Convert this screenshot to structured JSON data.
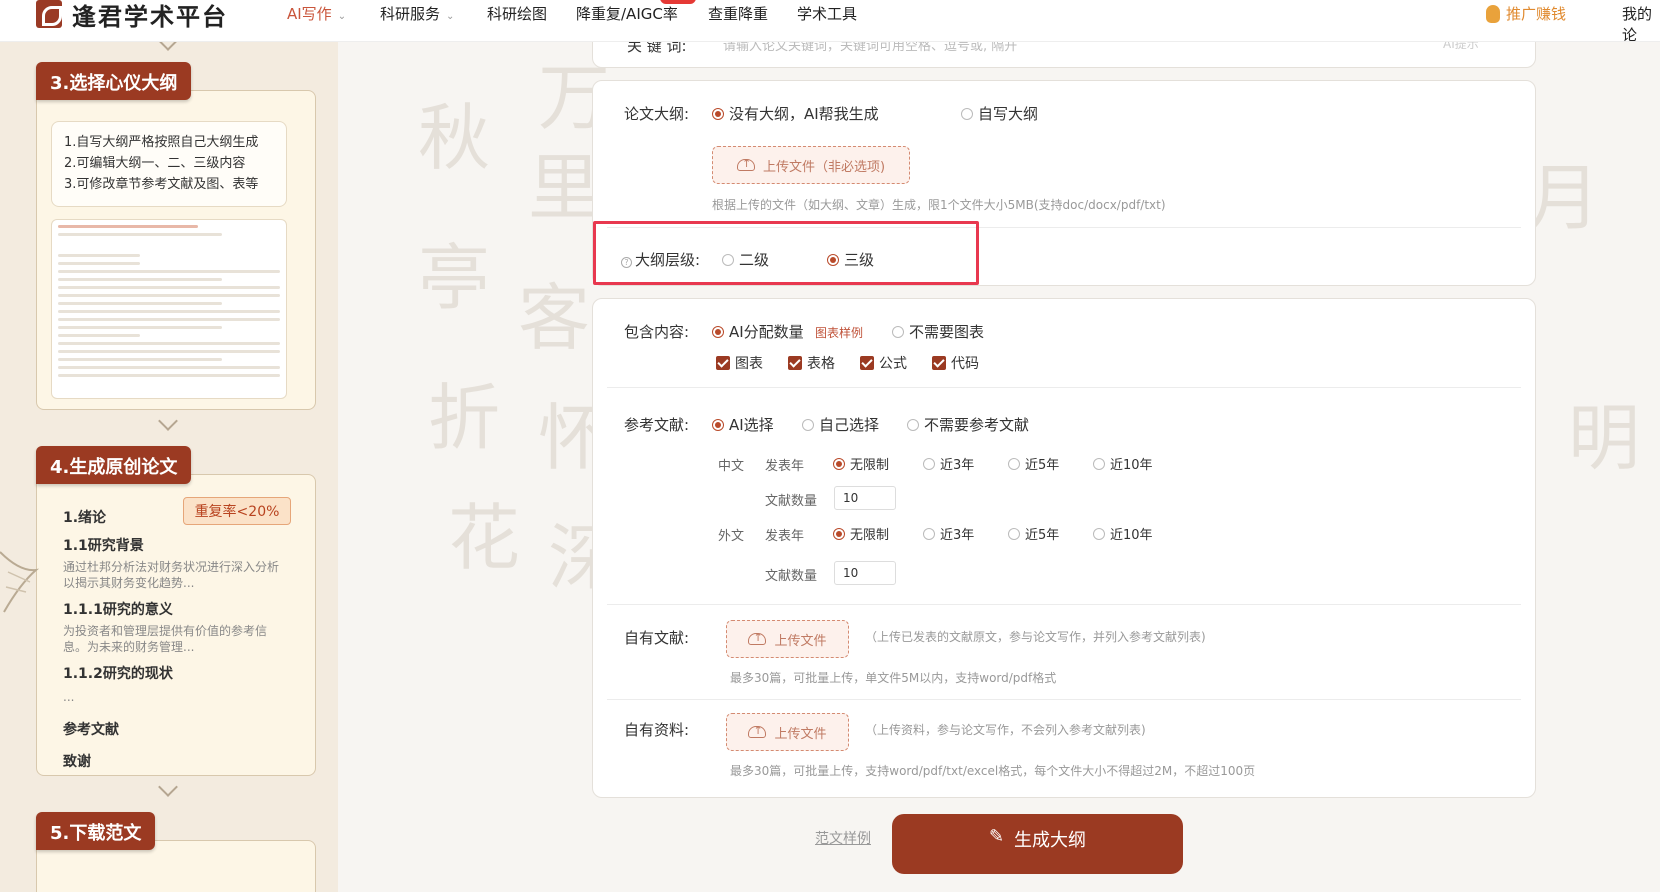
{
  "brand": {
    "name": "逢君学术平台"
  },
  "nav": {
    "items": [
      {
        "label": "AI写作",
        "caret": "⌄"
      },
      {
        "label": "科研服务",
        "caret": "⌄"
      },
      {
        "label": "科研绘图"
      },
      {
        "label": "降重复/AIGC率"
      },
      {
        "label": "查重降重"
      },
      {
        "label": "学术工具"
      }
    ],
    "promo": "推广赚钱",
    "account": "我的论"
  },
  "sidebar": {
    "step3": {
      "title": "3.选择心仪大纲",
      "tips": [
        "1.自写大纲严格按照自己大纲生成",
        "2.可编辑大纲一、二、三级内容",
        "3.可修改章节参考文献及图、表等"
      ]
    },
    "step4": {
      "title": "4.生成原创论文",
      "badge": "重复率<20%",
      "outline": [
        {
          "heading": "1.绪论"
        },
        {
          "heading": "1.1研究背景",
          "text": "通过杜邦分析法对财务状况进行深入分析以揭示其财务变化趋势..."
        },
        {
          "heading": "1.1.1研究的意义",
          "text": "为投资者和管理层提供有价值的参考信息。为未来的财务管理..."
        },
        {
          "heading": "1.1.2研究的现状"
        },
        {
          "heading": "..."
        },
        {
          "heading": "参考文献"
        },
        {
          "heading": "致谢"
        }
      ]
    },
    "step5": {
      "title": "5.下载范文"
    }
  },
  "form": {
    "keywords": {
      "label": "关 键 词:",
      "placeholder": "请输入论文关键词，关键词可用空格、逗号或, 隔开",
      "button": "AI提示"
    },
    "outline": {
      "label": "论文大纲:",
      "options": [
        {
          "label": "没有大纲，AI帮我生成",
          "selected": true
        },
        {
          "label": "自写大纲",
          "selected": false
        }
      ],
      "upload_label": "上传文件（非必选项)",
      "upload_hint": "根据上传的文件（如大纲、文章）生成，限1个文件大小5MB(支持doc/docx/pdf/txt)"
    },
    "level": {
      "label": "大纲层级:",
      "options": [
        {
          "label": "二级",
          "selected": false
        },
        {
          "label": "三级",
          "selected": true
        }
      ]
    },
    "content": {
      "label": "包含内容:",
      "options": [
        {
          "label": "AI分配数量",
          "selected": true
        },
        {
          "label": "不需要图表",
          "selected": false
        }
      ],
      "sample_link": "图表样例",
      "checks": [
        {
          "label": "图表",
          "checked": true
        },
        {
          "label": "表格",
          "checked": true
        },
        {
          "label": "公式",
          "checked": true
        },
        {
          "label": "代码",
          "checked": true
        }
      ]
    },
    "references": {
      "label": "参考文献:",
      "options": [
        {
          "label": "AI选择",
          "selected": true
        },
        {
          "label": "自己选择",
          "selected": false
        },
        {
          "label": "不需要参考文献",
          "selected": false
        }
      ],
      "cn": {
        "label": "中文",
        "year_label": "发表年",
        "years": [
          {
            "label": "无限制",
            "selected": true
          },
          {
            "label": "近3年",
            "selected": false
          },
          {
            "label": "近5年",
            "selected": false
          },
          {
            "label": "近10年",
            "selected": false
          }
        ],
        "count_label": "文献数量",
        "count": "10"
      },
      "en": {
        "label": "外文",
        "year_label": "发表年",
        "years": [
          {
            "label": "无限制",
            "selected": true
          },
          {
            "label": "近3年",
            "selected": false
          },
          {
            "label": "近5年",
            "selected": false
          },
          {
            "label": "近10年",
            "selected": false
          }
        ],
        "count_label": "文献数量",
        "count": "10"
      }
    },
    "own_refs": {
      "label": "自有文献:",
      "upload_label": "上传文件",
      "note": "（上传已发表的文献原文，参与论文写作，并列入参考文献列表)",
      "hint": "最多30篇，可批量上传，单文件5M以内，支持word/pdf格式"
    },
    "own_data": {
      "label": "自有资料:",
      "upload_label": "上传文件",
      "note": "（上传资料，参与论文写作，不会列入参考文献列表)",
      "hint": "最多30篇，可批量上传，支持word/pdf/txt/excel格式，每个文件大小不得超过2M，不超过100页"
    },
    "sample_link": "范文样例",
    "generate": "生成大纲"
  },
  "colors": {
    "brand": "#9b3a22",
    "accent": "#c9553b",
    "highlight": "#e8384f",
    "promo": "#e08a2f"
  }
}
